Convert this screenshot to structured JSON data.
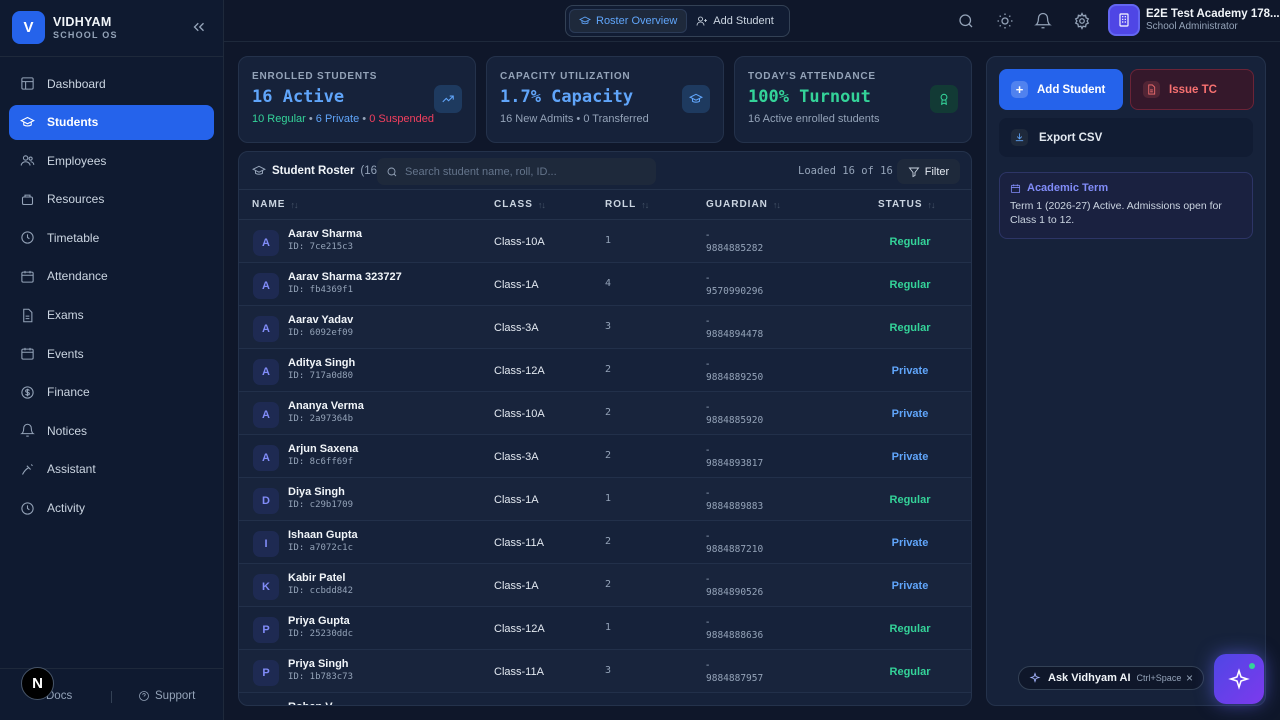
{
  "brand": {
    "logo_letter": "V",
    "name": "VIDHYAM",
    "subtitle": "SCHOOL OS"
  },
  "sidebar": {
    "items": [
      {
        "label": "Dashboard",
        "icon": "dashboard-icon",
        "active": false
      },
      {
        "label": "Students",
        "icon": "students-icon",
        "active": true
      },
      {
        "label": "Employees",
        "icon": "employees-icon",
        "active": false
      },
      {
        "label": "Resources",
        "icon": "resources-icon",
        "active": false
      },
      {
        "label": "Timetable",
        "icon": "clock-icon",
        "active": false
      },
      {
        "label": "Attendance",
        "icon": "calendar-icon",
        "active": false
      },
      {
        "label": "Exams",
        "icon": "document-icon",
        "active": false
      },
      {
        "label": "Events",
        "icon": "calendar-icon",
        "active": false
      },
      {
        "label": "Finance",
        "icon": "dollar-icon",
        "active": false
      },
      {
        "label": "Notices",
        "icon": "bell-icon",
        "active": false
      },
      {
        "label": "Assistant",
        "icon": "assistant-icon",
        "active": false
      },
      {
        "label": "Activity",
        "icon": "clock-icon",
        "active": false
      }
    ],
    "docs_label": "Docs",
    "support_label": "Support",
    "badge_letter": "N"
  },
  "topbar": {
    "tabs": [
      {
        "label": "Roster Overview",
        "active": true
      },
      {
        "label": "Add Student",
        "active": false
      }
    ],
    "profile_name": "E2E Test Academy 178...",
    "profile_role": "School Administrator"
  },
  "stats": [
    {
      "label": "ENROLLED STUDENTS",
      "value": "16 Active",
      "value_color": "#60a5fa",
      "sub_parts": [
        {
          "text": "10 Regular",
          "color": "#34d399"
        },
        {
          "text": " • ",
          "color": "#94a3b8"
        },
        {
          "text": "6 Private",
          "color": "#60a5fa"
        },
        {
          "text": " • ",
          "color": "#94a3b8"
        },
        {
          "text": "0 Suspended",
          "color": "#f43f5e"
        }
      ],
      "icon": "trend-up-icon",
      "icon_color": "#60a5fa",
      "icon_bg": "#1e3a5f"
    },
    {
      "label": "CAPACITY UTILIZATION",
      "value": "1.7% Capacity",
      "value_color": "#60a5fa",
      "sub": "16 New Admits • 0 Transferred",
      "icon": "graduation-cap-icon",
      "icon_color": "#60a5fa",
      "icon_bg": "#1e3a5f"
    },
    {
      "label": "TODAY'S ATTENDANCE",
      "value": "100% Turnout",
      "value_color": "#34d399",
      "sub": "16 Active enrolled students",
      "icon": "award-icon",
      "icon_color": "#34d399",
      "icon_bg": "#123a35"
    }
  ],
  "roster": {
    "title": "Student Roster",
    "count": "(16)",
    "search_placeholder": "Search student name, roll, ID...",
    "loaded_text": "Loaded 16 of 16",
    "filter_label": "Filter",
    "columns": [
      "NAME",
      "CLASS",
      "ROLL",
      "GUARDIAN",
      "STATUS"
    ],
    "status_colors": {
      "Regular": "#34d399",
      "Private": "#60a5fa"
    },
    "rows": [
      {
        "initial": "A",
        "name": "Aarav Sharma",
        "id": "ID: 7ce215c3",
        "class": "Class-10A",
        "roll": "1",
        "guardian": "-",
        "phone": "9884885282",
        "status": "Regular"
      },
      {
        "initial": "A",
        "name": "Aarav Sharma 323727",
        "id": "ID: fb4369f1",
        "class": "Class-1A",
        "roll": "4",
        "guardian": "-",
        "phone": "9570990296",
        "status": "Regular"
      },
      {
        "initial": "A",
        "name": "Aarav Yadav",
        "id": "ID: 6092ef09",
        "class": "Class-3A",
        "roll": "3",
        "guardian": "-",
        "phone": "9884894478",
        "status": "Regular"
      },
      {
        "initial": "A",
        "name": "Aditya Singh",
        "id": "ID: 717a0d80",
        "class": "Class-12A",
        "roll": "2",
        "guardian": "-",
        "phone": "9884889250",
        "status": "Private"
      },
      {
        "initial": "A",
        "name": "Ananya Verma",
        "id": "ID: 2a97364b",
        "class": "Class-10A",
        "roll": "2",
        "guardian": "-",
        "phone": "9884885920",
        "status": "Private"
      },
      {
        "initial": "A",
        "name": "Arjun Saxena",
        "id": "ID: 8c6ff69f",
        "class": "Class-3A",
        "roll": "2",
        "guardian": "-",
        "phone": "9884893817",
        "status": "Private"
      },
      {
        "initial": "D",
        "name": "Diya Singh",
        "id": "ID: c29b1709",
        "class": "Class-1A",
        "roll": "1",
        "guardian": "-",
        "phone": "9884889883",
        "status": "Regular"
      },
      {
        "initial": "I",
        "name": "Ishaan Gupta",
        "id": "ID: a7072c1c",
        "class": "Class-11A",
        "roll": "2",
        "guardian": "-",
        "phone": "9884887210",
        "status": "Private"
      },
      {
        "initial": "K",
        "name": "Kabir Patel",
        "id": "ID: ccbdd842",
        "class": "Class-1A",
        "roll": "2",
        "guardian": "-",
        "phone": "9884890526",
        "status": "Private"
      },
      {
        "initial": "P",
        "name": "Priya Gupta",
        "id": "ID: 25230ddc",
        "class": "Class-12A",
        "roll": "1",
        "guardian": "-",
        "phone": "9884888636",
        "status": "Regular"
      },
      {
        "initial": "P",
        "name": "Priya Singh",
        "id": "ID: 1b783c73",
        "class": "Class-11A",
        "roll": "3",
        "guardian": "-",
        "phone": "9884887957",
        "status": "Regular"
      },
      {
        "initial": "",
        "name": "Rohan V...",
        "id": "",
        "class": "",
        "roll": "",
        "guardian": "",
        "phone": "",
        "status": ""
      }
    ]
  },
  "actions": {
    "add_student": "Add Student",
    "issue_tc": "Issue TC",
    "export_csv": "Export CSV"
  },
  "term": {
    "title": "Academic Term",
    "text": "Term 1 (2026-27) Active. Admissions open for Class 1 to 12."
  },
  "ai": {
    "label": "Ask Vidhyam AI",
    "shortcut": "Ctrl+Space",
    "close": "×"
  }
}
